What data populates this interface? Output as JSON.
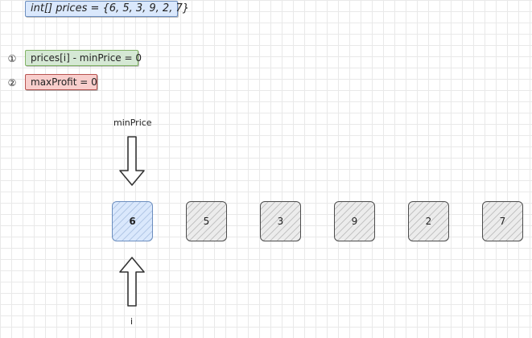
{
  "code": "int[] prices = {6, 5, 3, 9, 2, 7}",
  "steps": [
    {
      "mark": "①",
      "text": "prices[i] - minPrice = 0",
      "color": "#d5e8d4"
    },
    {
      "mark": "②",
      "text": "maxProfit = 0",
      "color": "#f8cecc"
    }
  ],
  "pointers": {
    "top_label": "minPrice",
    "bottom_label": "i"
  },
  "cells": [
    "6",
    "5",
    "3",
    "9",
    "2",
    "7"
  ],
  "active_index": 0
}
